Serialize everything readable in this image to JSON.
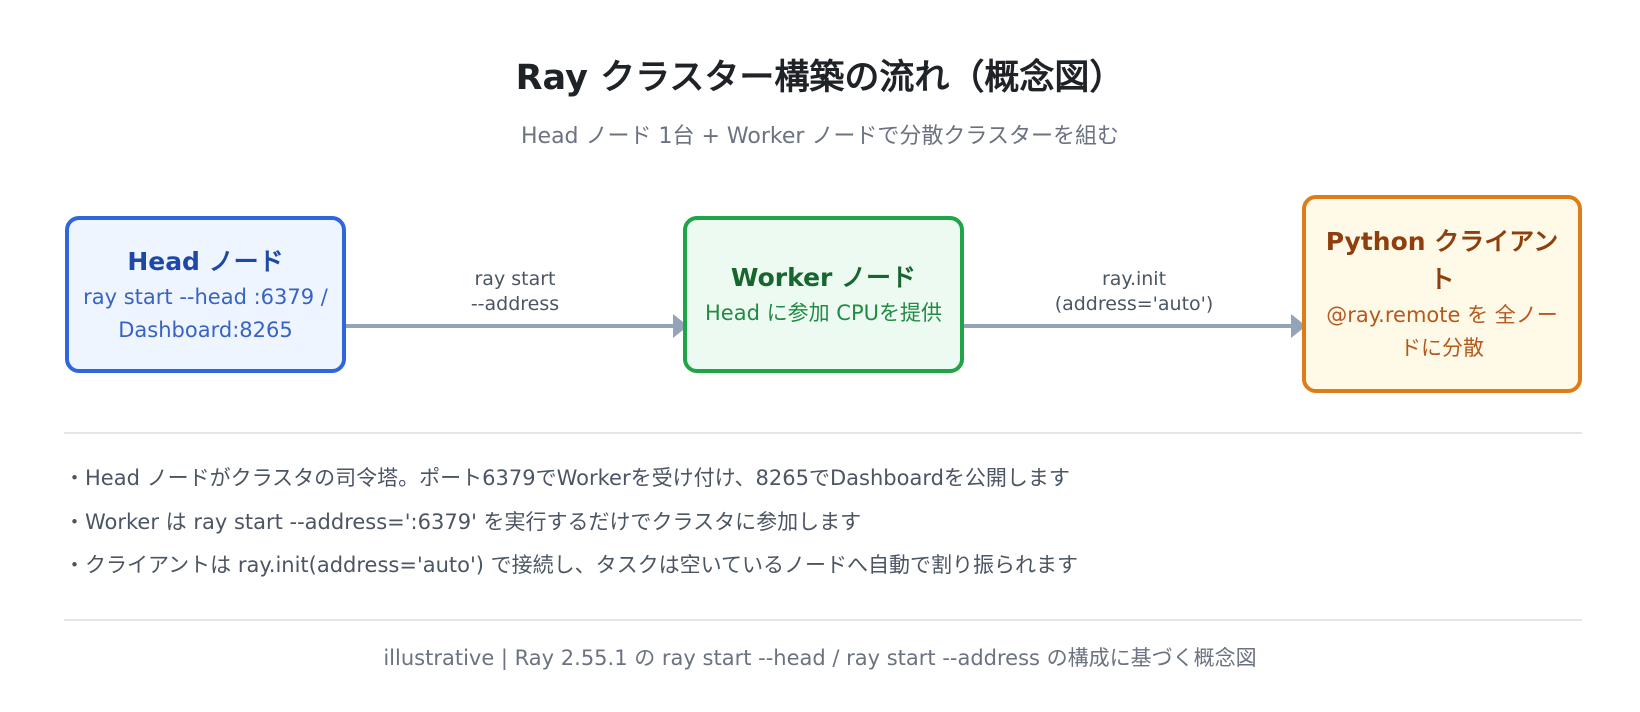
{
  "title": "Ray クラスター構築の流れ（概念図）",
  "subtitle": "Head ノード 1台 + Worker ノードで分散クラスターを組む",
  "nodes": {
    "head": {
      "title": "Head ノード",
      "desc": "ray start --head :6379 / Dashboard:8265"
    },
    "worker": {
      "title": "Worker ノード",
      "desc": "Head に参加 CPUを提供"
    },
    "client": {
      "title": "Python クライアント",
      "desc": "@ray.remote を 全ノードに分散"
    }
  },
  "edges": {
    "head_to_worker": {
      "line1": "ray start",
      "line2": "--address"
    },
    "worker_to_client": {
      "line1": "ray.init",
      "line2": "(address='auto')"
    }
  },
  "notes": [
    "・Head ノードがクラスタの司令塔。ポート6379でWorkerを受け付け、8265でDashboardを公開します",
    "・Worker は ray start --address=':6379' を実行するだけでクラスタに参加します",
    "・クライアントは ray.init(address='auto') で接続し、タスクは空いているノードへ自動で割り振られます"
  ],
  "footer": "illustrative | Ray 2.55.1 の ray start --head / ray start --address の構成に基づく概念図",
  "colors": {
    "head_border": "#2f66dc",
    "head_fill": "#eff5ff",
    "worker_border": "#1fa447",
    "worker_fill": "#edfaf1",
    "client_border": "#dc7d17",
    "client_fill": "#fff9e8",
    "edge": "#94a3b8"
  }
}
